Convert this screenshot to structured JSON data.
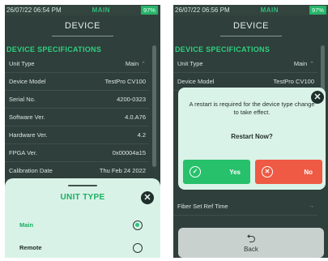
{
  "left": {
    "status": {
      "datetime": "26/07/22 06:54 PM",
      "mode": "MAIN",
      "battery": "97%"
    },
    "title": "DEVICE",
    "section": "DEVICE SPECIFICATIONS",
    "rows": [
      {
        "label": "Unit Type",
        "value": "Main"
      },
      {
        "label": "Device Model",
        "value": "TestPro CV100"
      },
      {
        "label": "Serial No.",
        "value": "4200-0323"
      },
      {
        "label": "Software Ver.",
        "value": "4.0.A76"
      },
      {
        "label": "Hardware Ver.",
        "value": "4.2"
      },
      {
        "label": "FPGA Ver.",
        "value": "0x00004a15"
      },
      {
        "label": "Calibration Date",
        "value": "Thu Feb 24 2022"
      }
    ],
    "sheet": {
      "title": "UNIT TYPE",
      "options": [
        "Main",
        "Remote"
      ],
      "selected": "Main"
    }
  },
  "right": {
    "status": {
      "datetime": "26/07/22 06:56 PM",
      "mode": "MAIN",
      "battery": "97%"
    },
    "title": "DEVICE",
    "section": "DEVICE SPECIFICATIONS",
    "rows": [
      {
        "label": "Unit Type",
        "value": "Main"
      },
      {
        "label": "Device Model",
        "value": "TestPro CV100"
      }
    ],
    "dialog": {
      "message": "A restart is required for the device type change to take effect.",
      "question": "Restart Now?",
      "yes": "Yes",
      "no": "No"
    },
    "bottom_row": {
      "label": "Fiber Set Ref Time"
    },
    "back": "Back"
  },
  "colors": {
    "accent": "#2fd07f",
    "background": "#2f3f3b",
    "yes": "#27c06b",
    "no": "#ee5a43"
  }
}
